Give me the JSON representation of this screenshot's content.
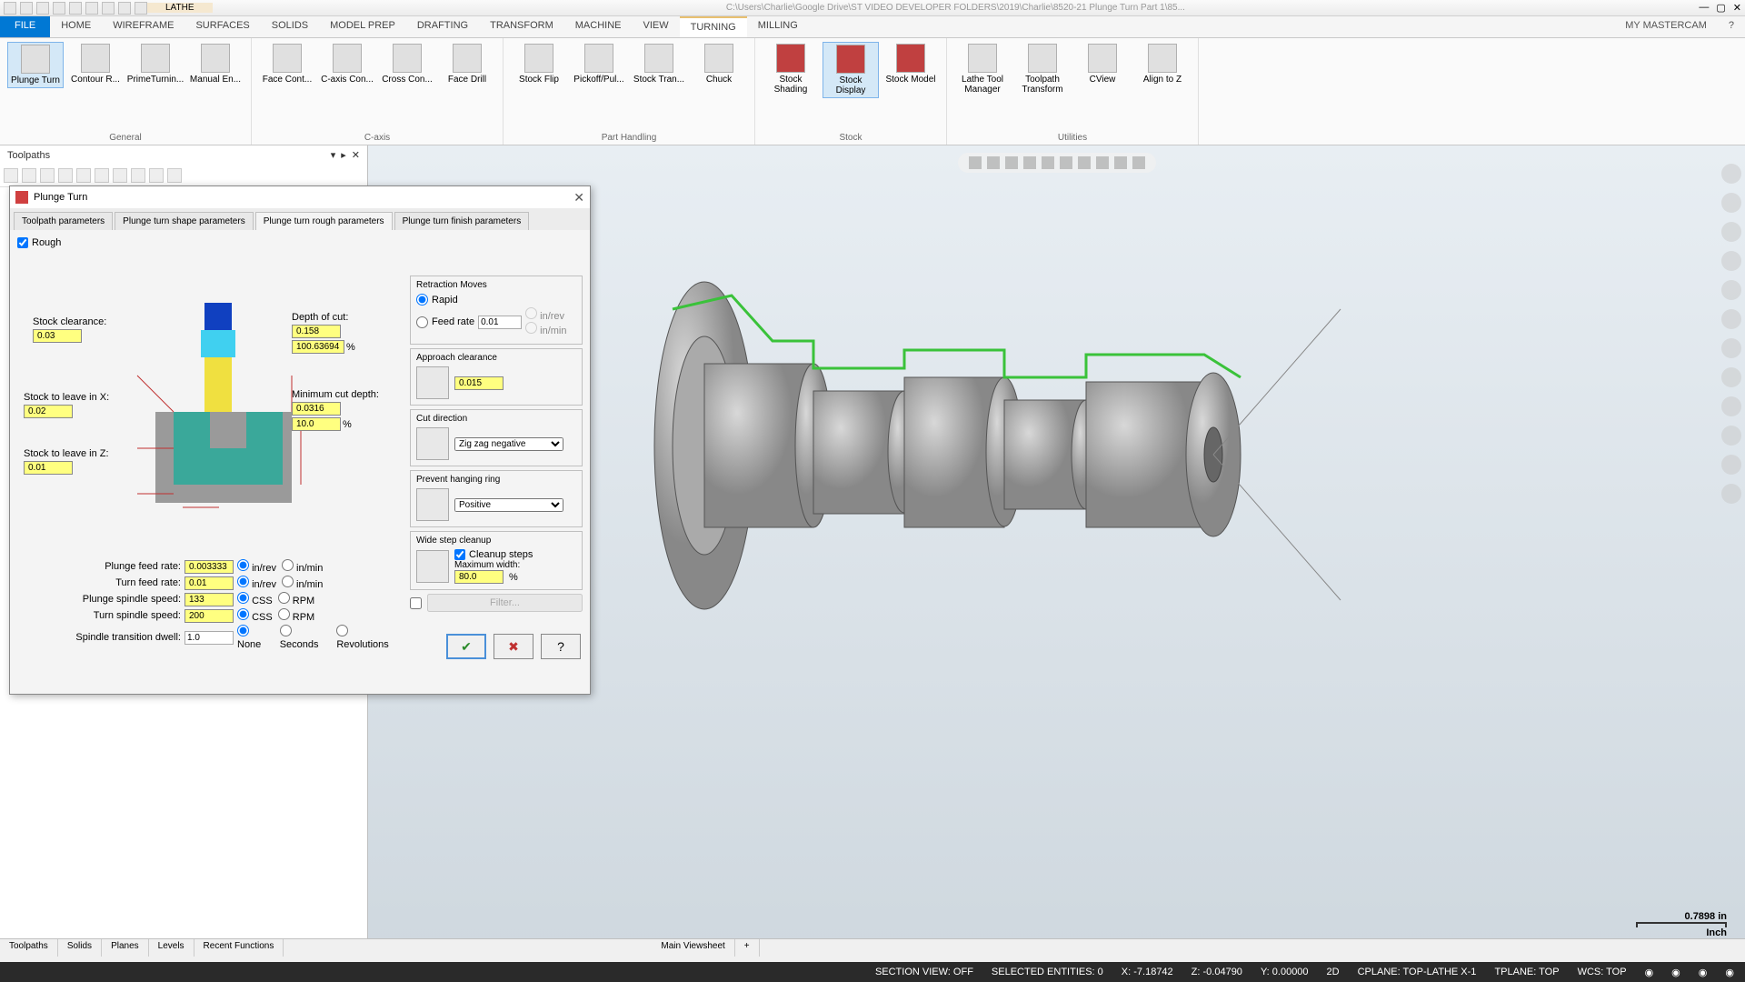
{
  "titlebar": {
    "context_tab": "LATHE",
    "path": "C:\\Users\\Charlie\\Google Drive\\ST VIDEO DEVELOPER FOLDERS\\2019\\Charlie\\8520-21 Plunge Turn Part 1\\85..."
  },
  "ribbon_tabs": {
    "file": "FILE",
    "items": [
      "HOME",
      "WIREFRAME",
      "SURFACES",
      "SOLIDS",
      "MODEL PREP",
      "DRAFTING",
      "TRANSFORM",
      "MACHINE",
      "VIEW",
      "TURNING",
      "MILLING"
    ],
    "active": "TURNING",
    "right": "MY MASTERCAM"
  },
  "ribbon": {
    "general": {
      "label": "General",
      "items": [
        "Plunge Turn",
        "Contour R...",
        "PrimeTurnin...",
        "Manual En..."
      ]
    },
    "caxis": {
      "label": "C-axis",
      "items": [
        "Face Cont...",
        "C-axis Con...",
        "Cross Con...",
        "Face Drill"
      ]
    },
    "part": {
      "label": "Part Handling",
      "items": [
        "Stock Flip",
        "Pickoff/Pul...",
        "Stock Tran...",
        "Chuck"
      ]
    },
    "stock": {
      "label": "Stock",
      "items": [
        "Stock Shading",
        "Stock Display",
        "Stock Model"
      ]
    },
    "util": {
      "label": "Utilities",
      "items": [
        "Lathe Tool Manager",
        "Toolpath Transform",
        "CView",
        "Align to Z"
      ]
    }
  },
  "panel": {
    "title": "Toolpaths"
  },
  "dialog": {
    "title": "Plunge Turn",
    "tabs": [
      "Toolpath parameters",
      "Plunge turn shape parameters",
      "Plunge turn rough parameters",
      "Plunge turn finish parameters"
    ],
    "active_tab": "Plunge turn rough parameters",
    "rough_label": "Rough",
    "rough_checked": true,
    "fields": {
      "stock_clearance": {
        "label": "Stock clearance:",
        "value": "0.03"
      },
      "stock_leave_x": {
        "label": "Stock to leave in X:",
        "value": "0.02"
      },
      "stock_leave_z": {
        "label": "Stock to leave in Z:",
        "value": "0.01"
      },
      "depth_cut": {
        "label": "Depth of cut:",
        "value": "0.158",
        "pct": "100.63694",
        "pct_unit": "%"
      },
      "min_cut_depth": {
        "label": "Minimum cut depth:",
        "value": "0.0316",
        "pct": "10.0",
        "pct_unit": "%"
      }
    },
    "bottom": {
      "plunge_feed": {
        "label": "Plunge feed rate:",
        "value": "0.003333"
      },
      "turn_feed": {
        "label": "Turn feed rate:",
        "value": "0.01"
      },
      "plunge_ss": {
        "label": "Plunge spindle speed:",
        "value": "133"
      },
      "turn_ss": {
        "label": "Turn spindle speed:",
        "value": "200"
      },
      "dwell": {
        "label": "Spindle transition dwell:",
        "value": "1.0"
      },
      "feed_units": [
        "in/rev",
        "in/min"
      ],
      "speed_units": [
        "CSS",
        "RPM"
      ],
      "dwell_units": [
        "None",
        "Seconds",
        "Revolutions"
      ]
    },
    "right": {
      "retraction": {
        "title": "Retraction Moves",
        "opts": [
          "Rapid",
          "Feed rate"
        ],
        "sel": "Rapid",
        "feed_val": "0.01",
        "u1": "in/rev",
        "u2": "in/min"
      },
      "approach": {
        "title": "Approach clearance",
        "value": "0.015"
      },
      "cutdir": {
        "title": "Cut direction",
        "value": "Zig zag negative"
      },
      "hanging": {
        "title": "Prevent hanging ring",
        "value": "Positive"
      },
      "wide": {
        "title": "Wide step cleanup",
        "chk": "Cleanup steps",
        "maxw_label": "Maximum width:",
        "maxw": "80.0",
        "pct": "%"
      },
      "filter": "Filter..."
    }
  },
  "scale": {
    "value": "0.7898 in",
    "unit": "Inch"
  },
  "footer_tabs": [
    "Toolpaths",
    "Solids",
    "Planes",
    "Levels",
    "Recent Functions"
  ],
  "viewsheet": "Main Viewsheet",
  "status": {
    "section": "SECTION VIEW: OFF",
    "selected": "SELECTED ENTITIES: 0",
    "x": "X: -7.18742",
    "z": "Z: -0.04790",
    "y": "Y: 0.00000",
    "d": "2D",
    "cplane": "CPLANE: TOP-LATHE X-1",
    "tplane": "TPLANE: TOP",
    "wcs": "WCS: TOP"
  }
}
